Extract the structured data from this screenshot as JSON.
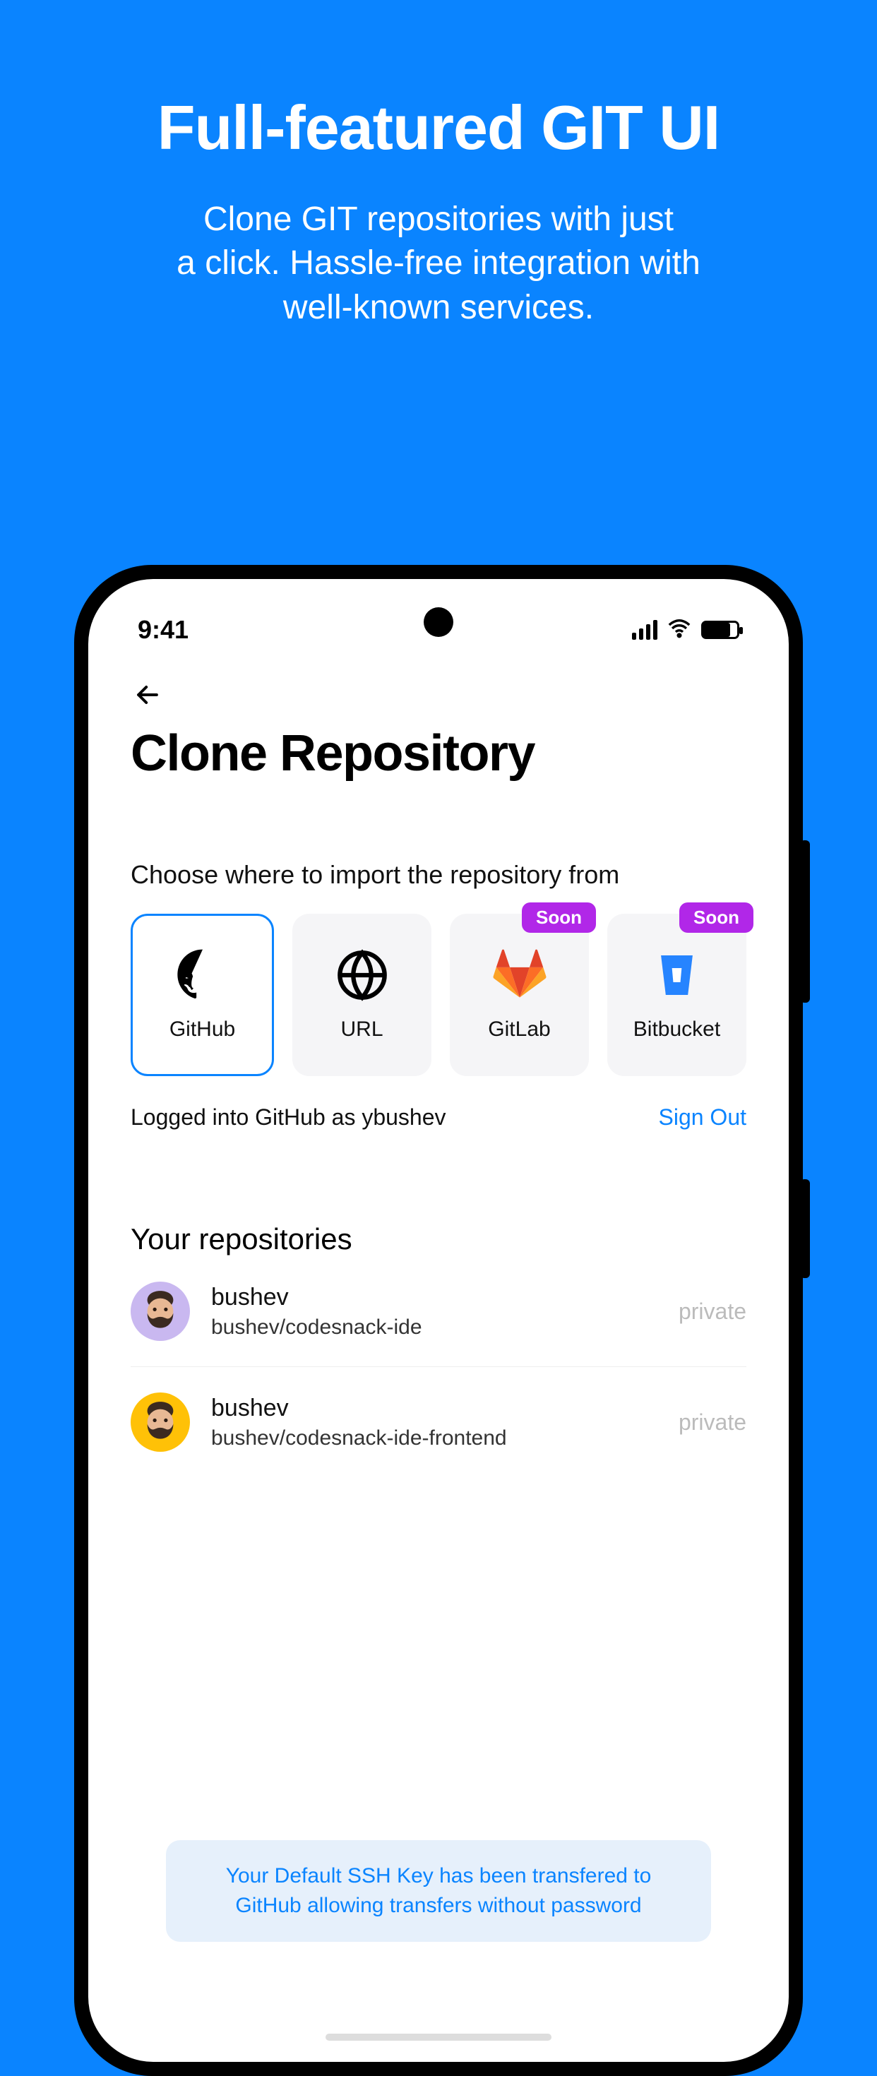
{
  "promo": {
    "title": "Full-featured GIT UI",
    "subtitle_l1": "Clone GIT repositories with just",
    "subtitle_l2": "a click. Hassle-free integration with",
    "subtitle_l3": "well-known services."
  },
  "statusbar": {
    "time": "9:41"
  },
  "page": {
    "title": "Clone Repository",
    "choose_label": "Choose where to import the repository from"
  },
  "sources": {
    "github": "GitHub",
    "url": "URL",
    "gitlab": "GitLab",
    "bitbucket": "Bitbucket",
    "soon": "Soon"
  },
  "auth": {
    "logged_in_text": "Logged into GitHub as ybushev",
    "signout": "Sign Out"
  },
  "repos": {
    "header": "Your repositories",
    "items": [
      {
        "owner": "bushev",
        "path": "bushev/codesnack-ide",
        "visibility": "private",
        "avatar_bg": "#c9b8f0"
      },
      {
        "owner": "bushev",
        "path": "bushev/codesnack-ide-frontend",
        "visibility": "private",
        "avatar_bg": "#ffc107"
      }
    ]
  },
  "banner": {
    "line1": "Your Default SSH Key has been transfered to",
    "line2": "GitHub allowing transfers without password"
  }
}
